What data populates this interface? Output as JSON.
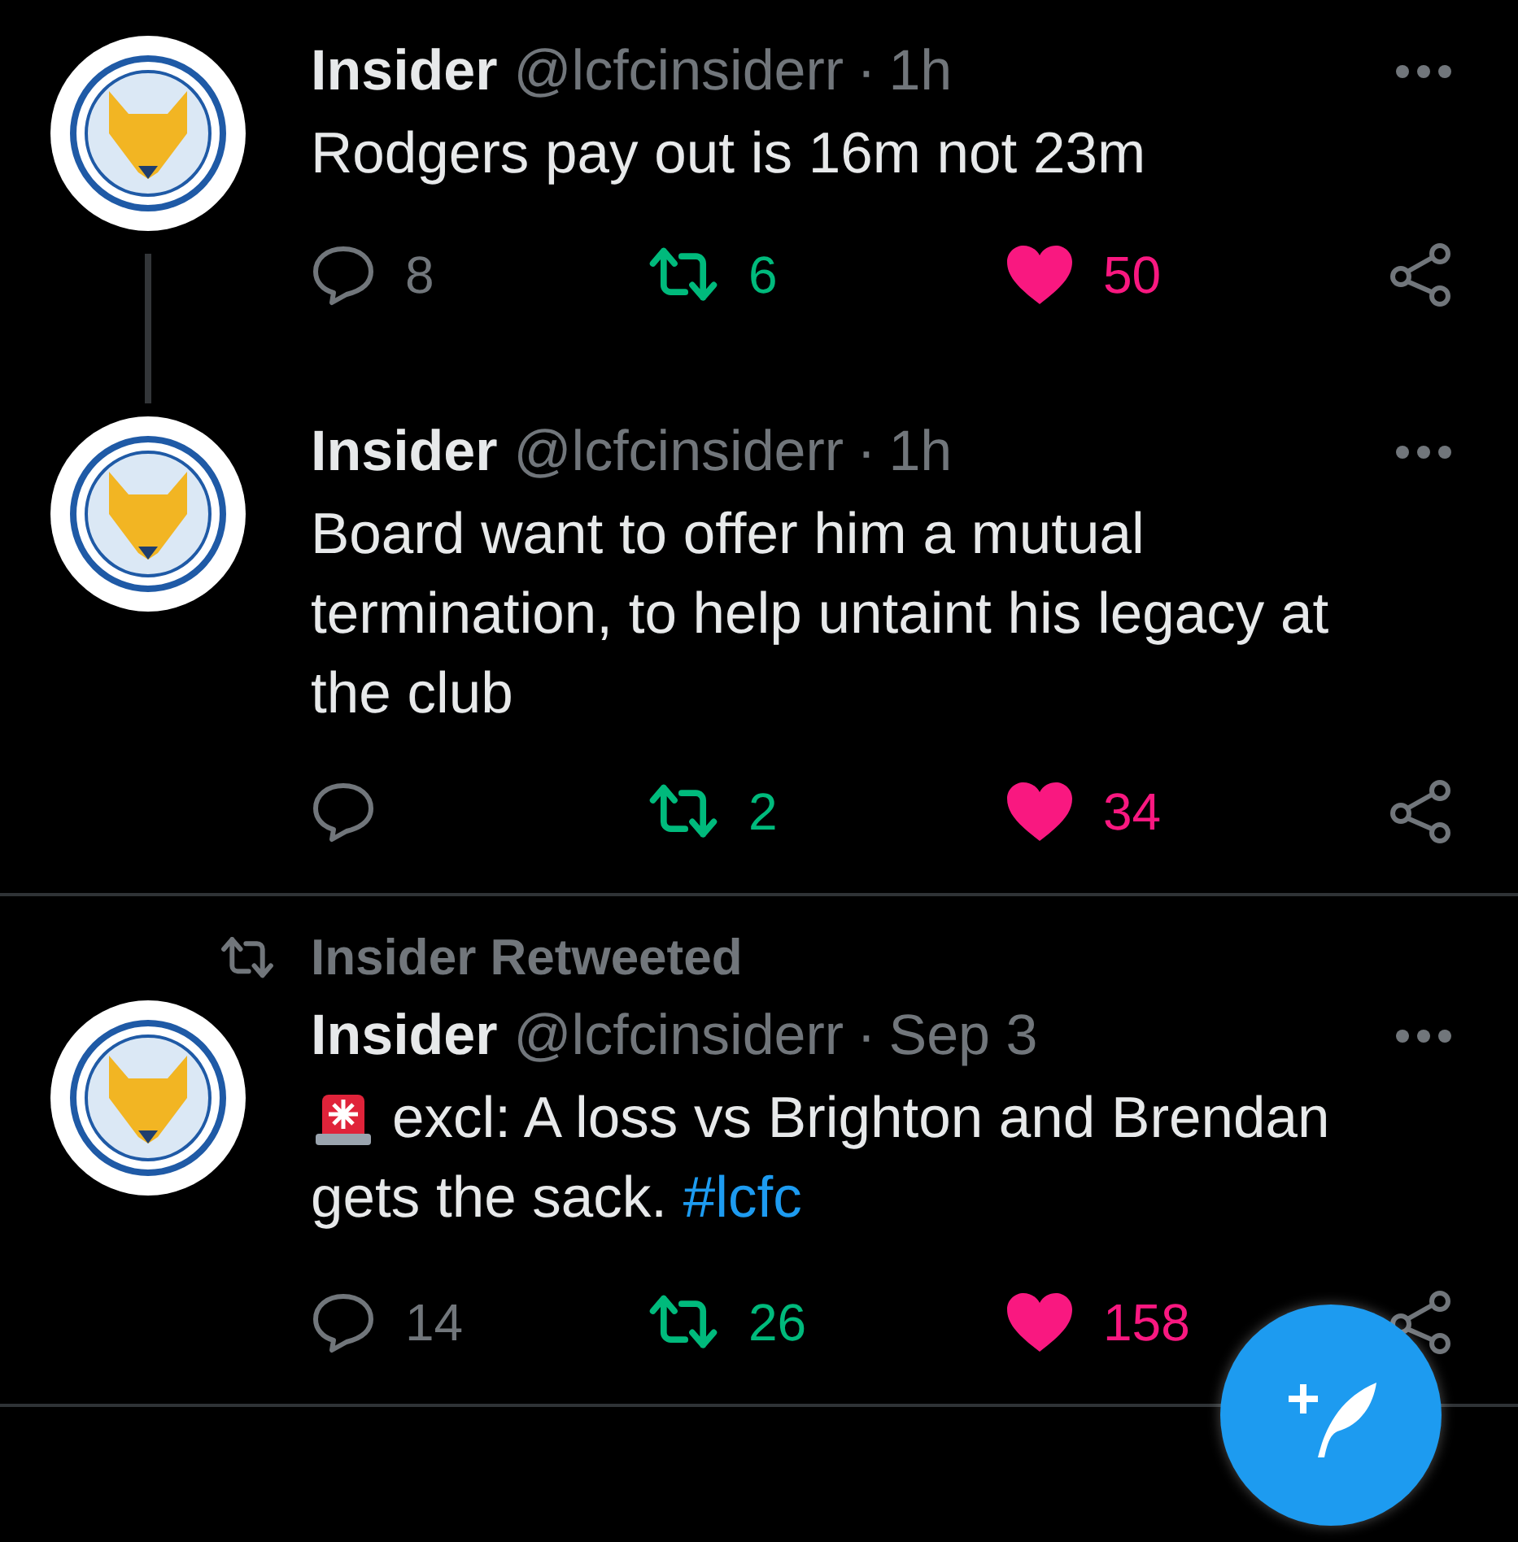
{
  "tweets": [
    {
      "author": "Insider",
      "handle": "@lcfcinsiderr",
      "separator": "·",
      "time": "1h",
      "text": "Rodgers pay out is 16m not 23m",
      "replies": "8",
      "retweets": "6",
      "likes": "50",
      "retweeted": true,
      "liked": true,
      "thread_continues": true
    },
    {
      "author": "Insider",
      "handle": "@lcfcinsiderr",
      "separator": "·",
      "time": "1h",
      "text": "Board want to offer him a mutual termination, to help untaint his legacy at the club",
      "retweets": "2",
      "likes": "34",
      "retweeted": true,
      "liked": true,
      "divider": true
    },
    {
      "retweeted_by": "Insider Retweeted",
      "author": "Insider",
      "handle": "@lcfcinsiderr",
      "separator": "·",
      "time": "Sep 3",
      "siren": true,
      "text": "excl: A loss vs Brighton and Brendan gets the sack.",
      "hashtag": "#lcfc",
      "replies": "14",
      "retweets": "26",
      "likes": "158",
      "retweeted": true,
      "liked": true,
      "divider": true
    }
  ],
  "compose_button": {
    "kind": "fab"
  }
}
